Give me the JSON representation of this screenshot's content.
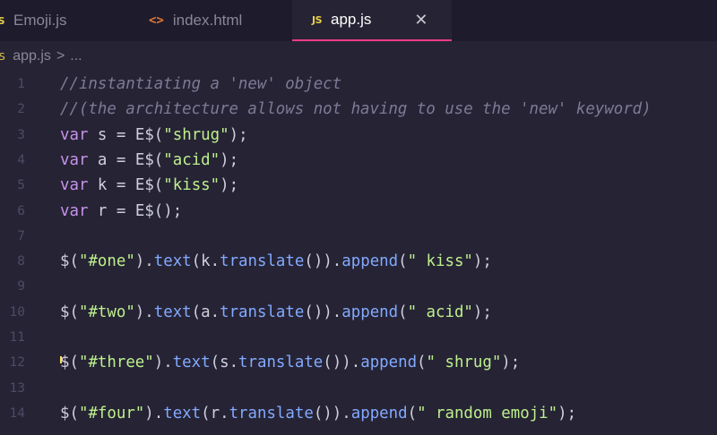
{
  "tabs": [
    {
      "icon": "JS",
      "label": "Emoji.js",
      "active": false
    },
    {
      "icon": "<>",
      "label": "index.html",
      "active": false
    },
    {
      "icon": "JS",
      "label": "app.js",
      "active": true
    }
  ],
  "close_symbol": "✕",
  "breadcrumb": {
    "icon": "JS",
    "file": "app.js",
    "sep": ">",
    "rest": "..."
  },
  "lines": [
    {
      "n": "1",
      "text": "//instantiating a 'new' object"
    },
    {
      "n": "2",
      "text": "//(the architecture allows not having to use the 'new' keyword)"
    },
    {
      "n": "3",
      "text": "var s = E$(\"shrug\");"
    },
    {
      "n": "4",
      "text": "var a = E$(\"acid\");"
    },
    {
      "n": "5",
      "text": "var k = E$(\"kiss\");"
    },
    {
      "n": "6",
      "text": "var r = E$();"
    },
    {
      "n": "7",
      "text": ""
    },
    {
      "n": "8",
      "text": "$(\"#one\").text(k.translate()).append(\" kiss\");"
    },
    {
      "n": "9",
      "text": ""
    },
    {
      "n": "10",
      "text": "$(\"#two\").text(a.translate()).append(\" acid\");"
    },
    {
      "n": "11",
      "text": ""
    },
    {
      "n": "12",
      "text": "$(\"#three\").text(s.translate()).append(\" shrug\");"
    },
    {
      "n": "13",
      "text": ""
    },
    {
      "n": "14",
      "text": "$(\"#four\").text(r.translate()).append(\" random emoji\");"
    }
  ]
}
